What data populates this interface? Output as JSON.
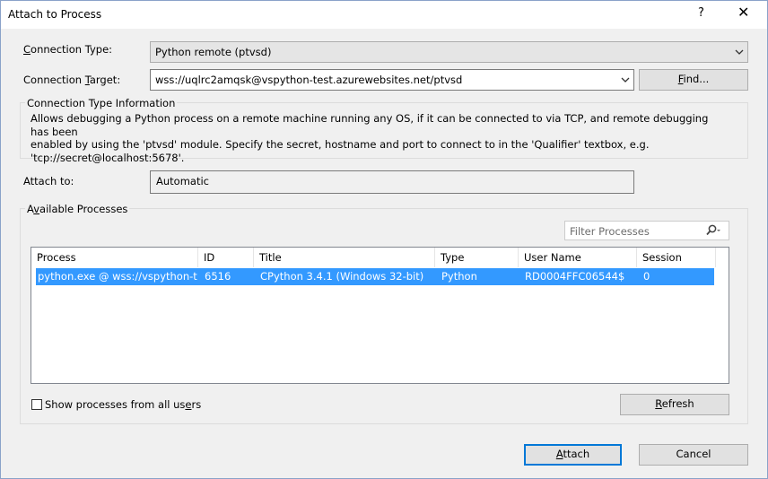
{
  "window": {
    "title": "Attach to Process",
    "help_label": "?",
    "close_label": "✕"
  },
  "connection_type": {
    "label": "Connection Type:",
    "value": "Python remote (ptvsd)"
  },
  "connection_target": {
    "label": "Connection Target:",
    "value": "wss://uqlrc2amqsk@vspython-test.azurewebsites.net/ptvsd",
    "find_button": "Find..."
  },
  "connection_info": {
    "legend": "Connection Type Information",
    "line1": "Allows debugging a Python process on a remote machine running any OS, if it can be connected to via TCP, and remote debugging has been",
    "line2": "enabled by using the 'ptvsd' module. Specify the secret, hostname and port to connect to in the 'Qualifier' textbox, e.g.",
    "line3": "'tcp://secret@localhost:5678'."
  },
  "attach_to": {
    "label": "Attach to:",
    "value": "Automatic"
  },
  "available_processes": {
    "legend": "Available Processes",
    "filter_placeholder": "Filter Processes",
    "columns": [
      "Process",
      "ID",
      "Title",
      "Type",
      "User Name",
      "Session"
    ],
    "rows": [
      {
        "process": "python.exe @ wss://vspython-t...",
        "id": "6516",
        "title": "CPython 3.4.1 (Windows 32-bit)",
        "type": "Python",
        "user": "RD0004FFC06544$",
        "session": "0"
      }
    ],
    "show_all_label": "Show processes from all users",
    "refresh_button": "Refresh"
  },
  "footer": {
    "attach_button": "Attach",
    "cancel_button": "Cancel"
  },
  "colors": {
    "selection": "#3399ff",
    "default_button_border": "#0078d7"
  }
}
